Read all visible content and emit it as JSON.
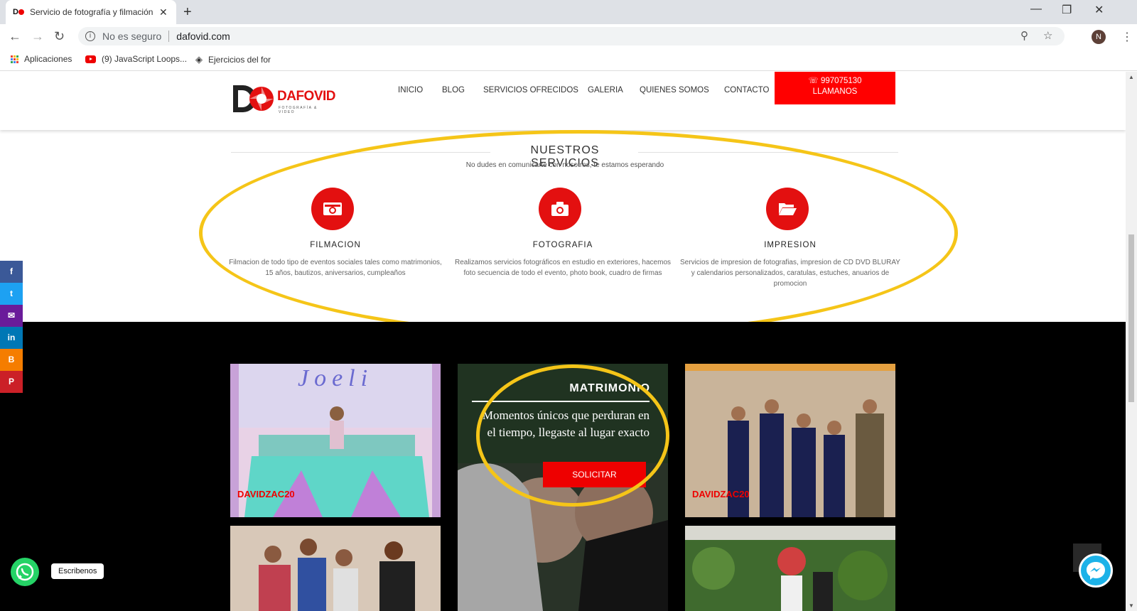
{
  "browser": {
    "tab_title": "Servicio de fotografía y filmación",
    "tab_favicon": "D",
    "security_label": "No es seguro",
    "url": "dafovid.com",
    "avatar_letter": "N",
    "bookmarks": [
      {
        "label": "Aplicaciones",
        "icon": "apps-grid-icon"
      },
      {
        "label": "(9) JavaScript Loops...",
        "icon": "youtube-icon"
      },
      {
        "label": "Ejercicios del for",
        "icon": "codepen-icon"
      }
    ]
  },
  "site": {
    "logo_text": "DAFOVID",
    "logo_tagline": "FOTOGRAFÍA & VIDEO",
    "nav": [
      "INICIO",
      "BLOG",
      "SERVICIOS OFRECIDOS",
      "GALERIA",
      "QUIENES SOMOS",
      "CONTACTO"
    ],
    "cta_phone": "997075130",
    "cta_label": "LLAMANOS"
  },
  "services": {
    "title": "NUESTROS SERVICIOS",
    "subtitle": "No dudes en comunicarte con nosotros, te estamos esperando",
    "items": [
      {
        "name": "FILMACION",
        "icon": "video-camera-icon",
        "description": "Filmacion de todo tipo de eventos sociales tales como matrimonios, 15 años, bautizos, aniversarios, cumpleaños"
      },
      {
        "name": "FOTOGRAFIA",
        "icon": "camera-icon",
        "description": "Realizamos servicios fotográficos en estudio en exteriores, hacemos foto secuencia de todo el evento, photo book, cuadro de firmas"
      },
      {
        "name": "IMPRESION",
        "icon": "folder-open-icon",
        "description": "Servicios de impresion de fotografias, impresion de CD DVD BLURAY y calendarios personalizados, caratulas, estuches, anuarios de promocion"
      }
    ]
  },
  "gallery": {
    "tile1_banner": "Joeli",
    "tile1_logo": "DAVIDZAC20",
    "featured_title": "MATRIMONIO",
    "featured_text": "Momentos únicos que perduran en el tiempo, llegaste al lugar exacto",
    "featured_button": "SOLICITAR",
    "tile3_logo": "DAVIDZAC20"
  },
  "widgets": {
    "whatsapp_label": "Escribenos",
    "social": [
      {
        "name": "facebook",
        "glyph": "f",
        "color": "#3b5998"
      },
      {
        "name": "twitter",
        "glyph": "t",
        "color": "#1da1f2"
      },
      {
        "name": "email",
        "glyph": "✉",
        "color": "#6a1b9a"
      },
      {
        "name": "linkedin",
        "glyph": "in",
        "color": "#0077b5"
      },
      {
        "name": "blogger",
        "glyph": "B",
        "color": "#f57d00"
      },
      {
        "name": "pinterest",
        "glyph": "P",
        "color": "#cb2027"
      }
    ]
  },
  "colors": {
    "brand_red": "#ff0000",
    "highlight_yellow": "#f5c518"
  }
}
